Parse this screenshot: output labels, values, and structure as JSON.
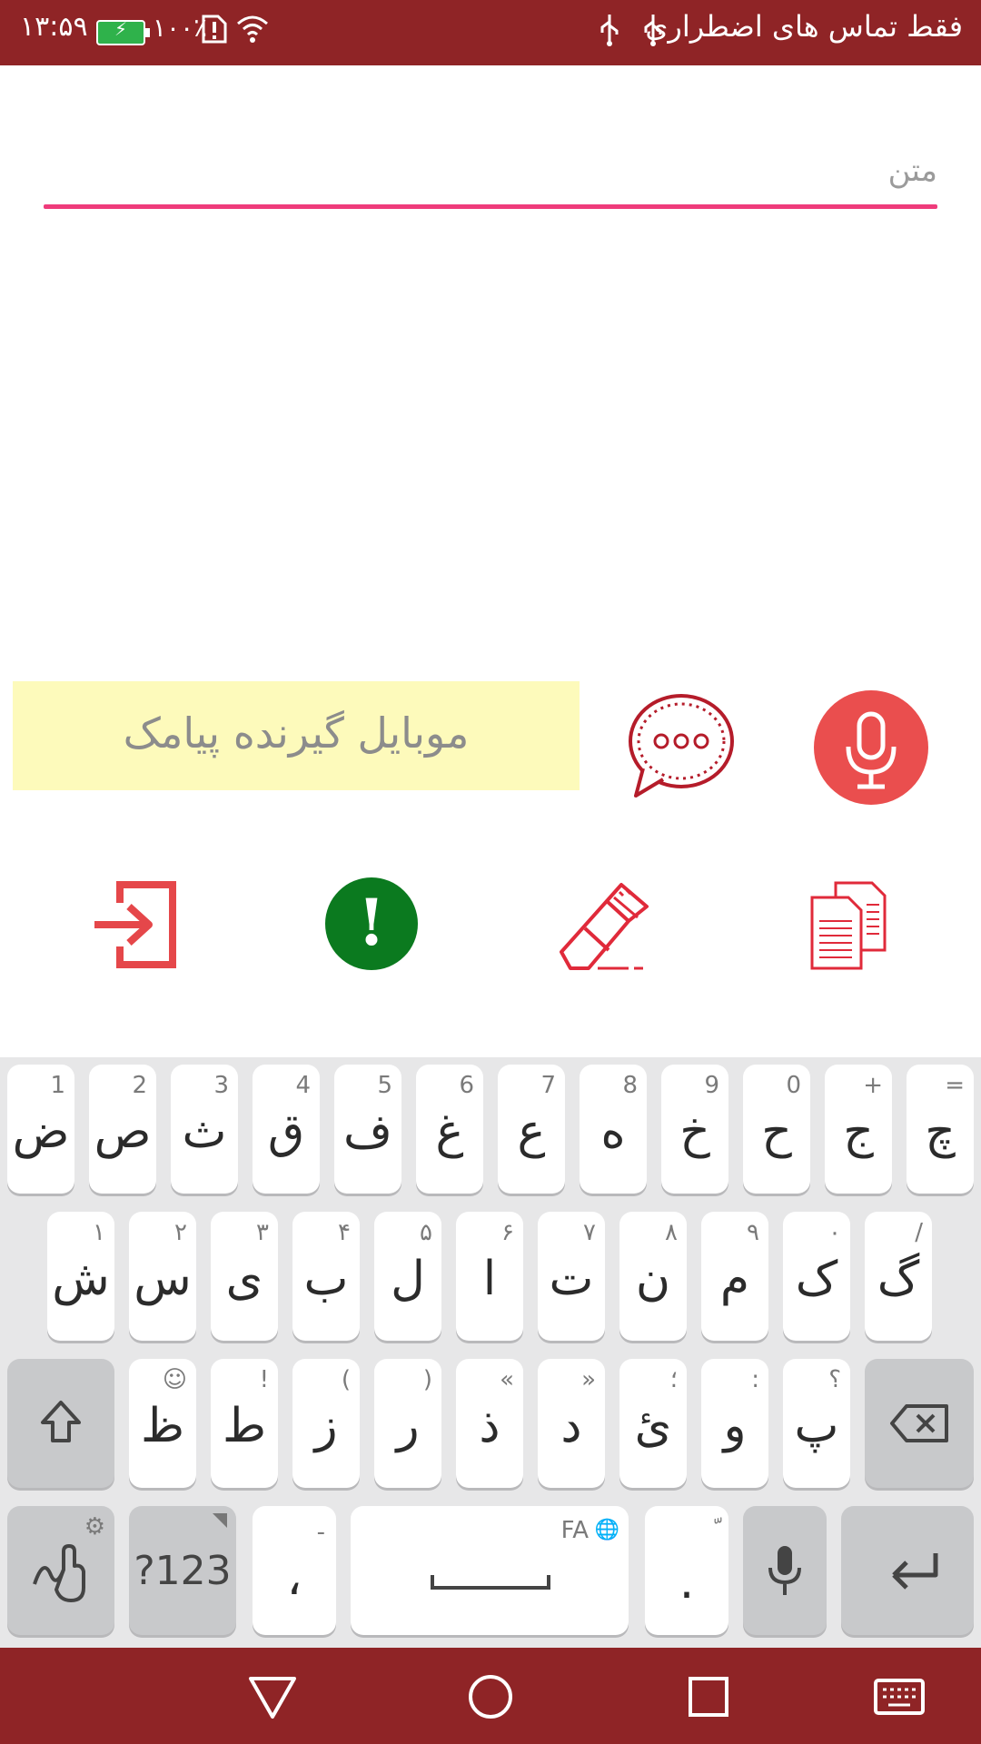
{
  "status_bar": {
    "time": "۱۳:۵۹",
    "battery_percent": "۱۰۰٪",
    "title": "فقط تماس های اضطراری"
  },
  "text_field": {
    "label": "متن"
  },
  "recipient": {
    "placeholder": "موبایل گیرنده پیامک"
  },
  "keyboard": {
    "row1": [
      {
        "main": "ض",
        "hint": "1"
      },
      {
        "main": "ص",
        "hint": "2"
      },
      {
        "main": "ث",
        "hint": "3"
      },
      {
        "main": "ق",
        "hint": "4"
      },
      {
        "main": "ف",
        "hint": "5"
      },
      {
        "main": "غ",
        "hint": "6"
      },
      {
        "main": "ع",
        "hint": "7"
      },
      {
        "main": "ه",
        "hint": "8"
      },
      {
        "main": "خ",
        "hint": "9"
      },
      {
        "main": "ح",
        "hint": "0"
      },
      {
        "main": "ج",
        "hint": "+"
      },
      {
        "main": "چ",
        "hint": "="
      }
    ],
    "row2": [
      {
        "main": "ش",
        "hint": "۱"
      },
      {
        "main": "س",
        "hint": "۲"
      },
      {
        "main": "ی",
        "hint": "۳"
      },
      {
        "main": "ب",
        "hint": "۴"
      },
      {
        "main": "ل",
        "hint": "۵"
      },
      {
        "main": "ا",
        "hint": "۶"
      },
      {
        "main": "ت",
        "hint": "۷"
      },
      {
        "main": "ن",
        "hint": "۸"
      },
      {
        "main": "م",
        "hint": "۹"
      },
      {
        "main": "ک",
        "hint": "۰"
      },
      {
        "main": "گ",
        "hint": "/"
      }
    ],
    "row3": [
      {
        "main": "ظ",
        "hint": "☺"
      },
      {
        "main": "ط",
        "hint": "!"
      },
      {
        "main": "ز",
        "hint": "("
      },
      {
        "main": "ر",
        "hint": ")"
      },
      {
        "main": "ذ",
        "hint": "«"
      },
      {
        "main": "د",
        "hint": "»"
      },
      {
        "main": "ئ",
        "hint": "؛"
      },
      {
        "main": "و",
        "hint": ":"
      },
      {
        "main": "پ",
        "hint": "؟"
      }
    ],
    "numbers_key": "?123",
    "comma_key": {
      "main": "،",
      "hint": "-"
    },
    "space_key_hint": "FA",
    "period_key": {
      "main": ".",
      "hint": "ّ"
    }
  },
  "icons": {
    "mic": "microphone-icon",
    "chat": "chat-bubble-icon",
    "exit": "exit-icon",
    "alert": "alert-icon",
    "eraser": "eraser-icon",
    "copy": "copy-icon"
  },
  "alert_glyph": "!",
  "colors": {
    "status_bar": "#8f2426",
    "accent_line": "#ef3b7b",
    "mic_red": "#ea4e4e",
    "alert_green": "#0b7a1f",
    "recipient_bg": "#fdfabb"
  }
}
